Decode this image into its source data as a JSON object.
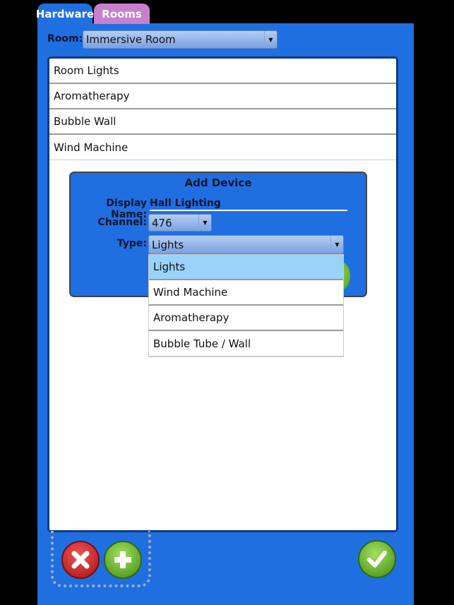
{
  "tabs": [
    {
      "label": "Hardware",
      "active": true
    },
    {
      "label": "Rooms",
      "active": false
    }
  ],
  "room": {
    "label": "Room:",
    "value": "Immersive Room"
  },
  "devices": [
    "Room Lights",
    "Aromatherapy",
    "Bubble Wall",
    "Wind Machine"
  ],
  "add_device": {
    "title": "Add Device",
    "display_name_label": "Display Name:",
    "display_name_value": "Hall Lighting",
    "channel_label": "Channel:",
    "channel_value": "476",
    "type_label": "Type:",
    "type_value": "Lights",
    "type_options": [
      "Lights",
      "Wind Machine",
      "Aromatherapy",
      "Bubble Tube / Wall"
    ],
    "selected_option": "Lights"
  },
  "icons": {
    "dropdown_arrow": "▼",
    "delete": "close-icon",
    "add": "plus-icon",
    "confirm": "check-icon"
  },
  "colors": {
    "panel": "#1f6fe0",
    "rooms_tab": "#c77fce",
    "selected_option": "#99d3fb"
  }
}
